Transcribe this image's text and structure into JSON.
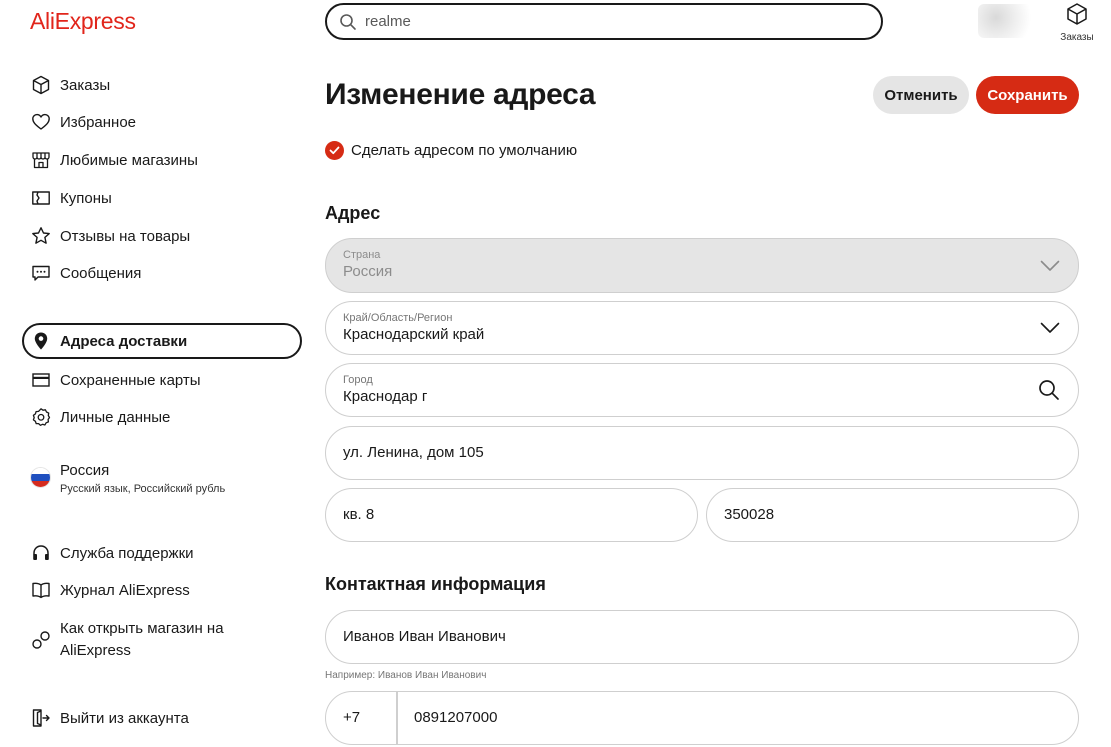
{
  "header": {
    "logo": "AliExpress",
    "search": {
      "value": "realme",
      "placeholder": ""
    },
    "orders_label": "Заказы"
  },
  "sidebar": {
    "items": [
      {
        "label": "Заказы",
        "icon": "box-icon"
      },
      {
        "label": "Избранное",
        "icon": "heart-icon"
      },
      {
        "label": "Любимые магазины",
        "icon": "store-icon"
      },
      {
        "label": "Купоны",
        "icon": "coupon-icon"
      },
      {
        "label": "Отзывы на товары",
        "icon": "star-icon"
      },
      {
        "label": "Сообщения",
        "icon": "message-icon"
      },
      {
        "label": "Адреса доставки",
        "icon": "location-pin-icon",
        "active": true
      },
      {
        "label": "Сохраненные карты",
        "icon": "card-icon"
      },
      {
        "label": "Личные данные",
        "icon": "gear-icon"
      }
    ],
    "region": {
      "country": "Россия",
      "details": "Русский язык, Российский рубль"
    },
    "support_items": [
      {
        "label": "Служба поддержки",
        "icon": "headphones-icon"
      },
      {
        "label": "Журнал AliExpress",
        "icon": "book-icon"
      },
      {
        "label": "Как открыть магазин на AliExpress",
        "icon": "link-icon"
      }
    ],
    "logout": {
      "label": "Выйти из аккаунта",
      "icon": "logout-icon"
    }
  },
  "main": {
    "title": "Изменение адреса",
    "cancel_label": "Отменить",
    "save_label": "Сохранить",
    "default_checkbox": {
      "label": "Сделать адресом по умолчанию",
      "checked": true
    },
    "address_section": "Адрес",
    "country": {
      "label": "Страна",
      "value": "Россия"
    },
    "region": {
      "label": "Край/Область/Регион",
      "value": "Краснодарский край"
    },
    "city": {
      "label": "Город",
      "value": "Краснодар г"
    },
    "street": {
      "value": "ул. Ленина, дом 105"
    },
    "apartment": {
      "value": "кв. 8"
    },
    "postal_code": {
      "value": "350028"
    },
    "contact_section": "Контактная информация",
    "full_name": {
      "value": "Иванов Иван Иванович",
      "hint": "Например: Иванов Иван Иванович"
    },
    "phone": {
      "code": "+7",
      "number": "0891207000"
    }
  },
  "colors": {
    "accent": "#d62b14",
    "logo": "#e1251b",
    "disabled_bg": "#e5e5e5",
    "border": "#cfcfcf"
  }
}
